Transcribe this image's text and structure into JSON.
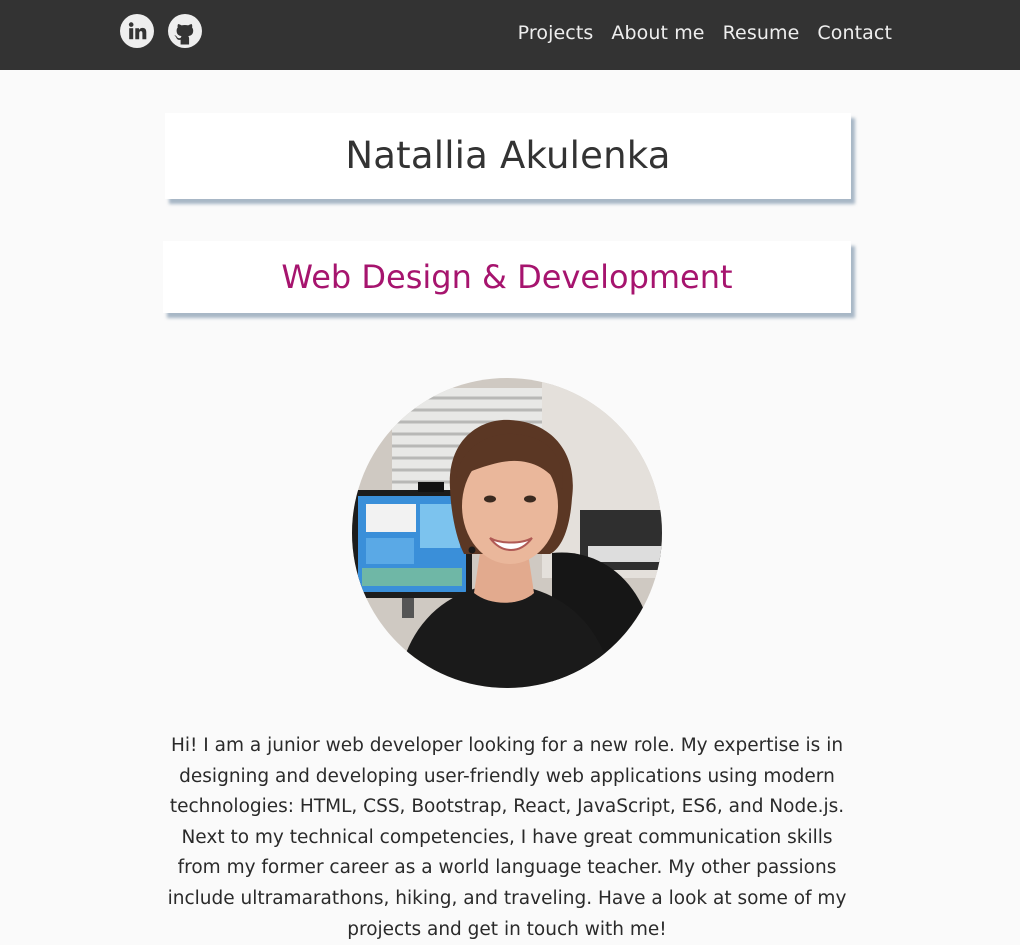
{
  "navbar": {
    "background": "#333333",
    "icons": [
      {
        "name": "linkedin-icon"
      },
      {
        "name": "github-icon"
      }
    ],
    "links": [
      {
        "label": "Projects"
      },
      {
        "label": "About me"
      },
      {
        "label": "Resume"
      },
      {
        "label": "Contact"
      }
    ]
  },
  "header": {
    "name": "Natallia Akulenka",
    "role": "Web Design & Development",
    "role_color": "#a6146e"
  },
  "profile": {
    "photo_icon": "profile-photo"
  },
  "bio": {
    "text": "Hi! I am a junior web developer looking for a new role. My expertise is in designing and developing user-friendly web applications using modern technologies: HTML, CSS, Bootstrap, React, JavaScript, ES6, and Node.js. Next to my technical competencies, I have great communication skills from my former career as a world language teacher. My other passions include ultramarathons, hiking, and traveling. Have a look at some of my projects and get in touch with me!"
  }
}
